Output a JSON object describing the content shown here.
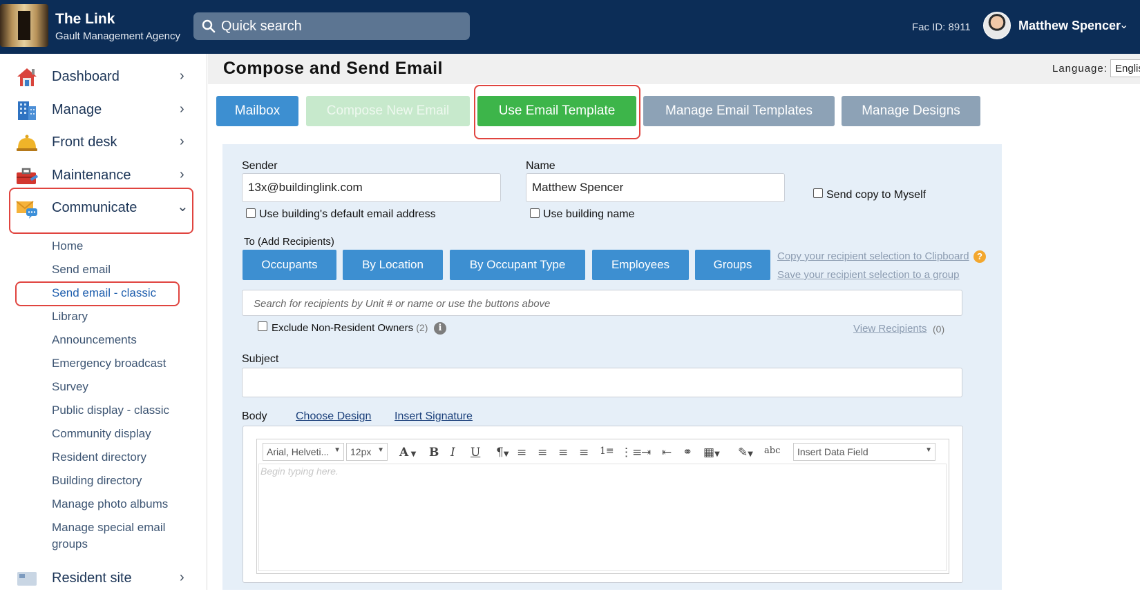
{
  "header": {
    "app_title": "The Link",
    "company": "Gault Management Agency",
    "search_placeholder": "Quick search",
    "fac_id": "Fac ID: 8911",
    "user_name": "Matthew Spencer"
  },
  "sidebar": {
    "items": [
      {
        "label": "Dashboard",
        "icon": "house-icon"
      },
      {
        "label": "Manage",
        "icon": "building-icon"
      },
      {
        "label": "Front desk",
        "icon": "bell-icon"
      },
      {
        "label": "Maintenance",
        "icon": "toolbox-icon"
      },
      {
        "label": "Communicate",
        "icon": "envelope-chat-icon"
      },
      {
        "label": "Resident site",
        "icon": "resident-site-icon"
      }
    ],
    "communicate_sub": [
      "Home",
      "Send email",
      "Send email - classic",
      "Library",
      "Announcements",
      "Emergency broadcast",
      "Survey",
      "Public display - classic",
      "Community display",
      "Resident directory",
      "Building directory",
      "Manage photo albums",
      "Manage special email",
      "groups"
    ]
  },
  "main": {
    "title": "Compose and Send Email",
    "language_label": "Language:",
    "language_value": "English",
    "actions": {
      "mailbox": "Mailbox",
      "compose": "Compose New Email",
      "use_template": "Use Email Template",
      "manage_templates": "Manage Email Templates",
      "manage_designs": "Manage Designs"
    }
  },
  "form": {
    "sender_label": "Sender",
    "sender_value": "13x@buildinglink.com",
    "name_label": "Name",
    "name_value": "Matthew Spencer",
    "default_email_cb": "Use building's default email address",
    "building_name_cb": "Use building name",
    "send_copy_cb": "Send copy to Myself",
    "to_label": "To (Add Recipients)",
    "recipient_buttons": [
      "Occupants",
      "By Location",
      "By Occupant Type",
      "Employees",
      "Groups"
    ],
    "copy_link": "Copy your recipient selection to Clipboard",
    "save_link": "Save your recipient selection to a group",
    "recipient_search_placeholder": "Search for recipients by Unit # or name or use the buttons above",
    "exclude_label": "Exclude Non-Resident Owners",
    "exclude_count": "(2)",
    "view_recipients": "View Recipients",
    "view_count": "(0)",
    "subject_label": "Subject",
    "body_label": "Body",
    "choose_design": "Choose Design",
    "insert_signature": "Insert Signature"
  },
  "editor": {
    "font_family": "Arial, Helveti...",
    "font_size": "12px",
    "data_field": "Insert Data Field",
    "placeholder": "Begin typing here."
  },
  "colors": {
    "header_bg": "#0c2d57",
    "primary_blue": "#3d8fd1",
    "green": "#3db54a",
    "grey_button": "#8da2b6",
    "highlight_red": "#e0443f"
  }
}
